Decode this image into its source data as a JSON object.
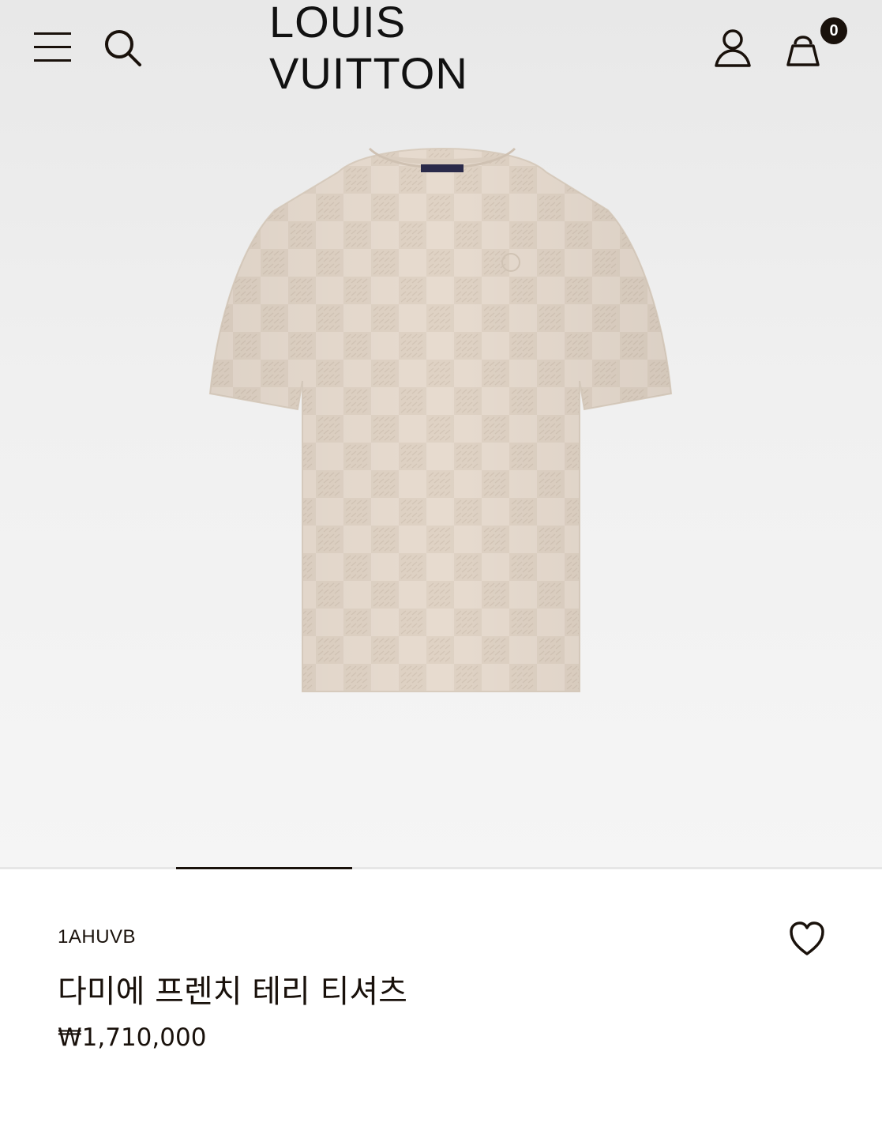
{
  "header": {
    "brand": "LOUIS VUITTON",
    "cart_count": "0",
    "icons": [
      "menu-icon",
      "search-icon",
      "account-icon",
      "shopping-bag-icon"
    ]
  },
  "gallery": {
    "progress": 0.2
  },
  "product": {
    "sku": "1AHUVB",
    "name": "다미에 프렌치 테리 티셔츠",
    "price": "₩1,710,000",
    "color": "#e7dbcf"
  },
  "colors": {
    "text": "#19110b",
    "background": "#ffffff"
  }
}
